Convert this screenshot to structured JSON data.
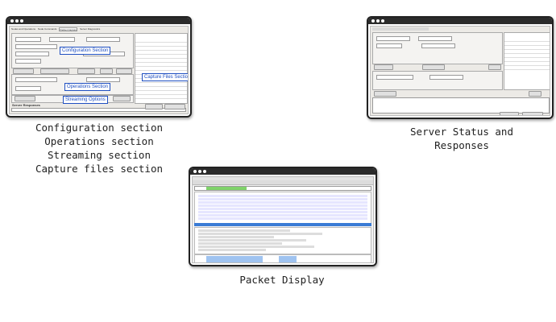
{
  "figures": [
    {
      "id": "configuration",
      "tabs": [
        "Nodes and Operations",
        "Node Commands",
        "Packet Capture",
        "Server Diagnostics"
      ],
      "labels": [
        "Configuration Section",
        "Operations Section",
        "Streaming Options",
        "Capture Files Section"
      ],
      "bottom_title": "Server Responses"
    },
    {
      "id": "server_status"
    },
    {
      "id": "packet_display"
    }
  ],
  "captions": {
    "left": [
      "Configuration section",
      "Operations section",
      "Streaming section",
      "Capture files section"
    ],
    "right": [
      "Server Status and",
      "Responses"
    ],
    "bottom": [
      "Packet Display"
    ]
  },
  "colors": {
    "frame_border": "#222222",
    "label_blue": "#1f4fc1",
    "selected_row": "#3a7bd5",
    "green_bar": "#7fd36a"
  }
}
